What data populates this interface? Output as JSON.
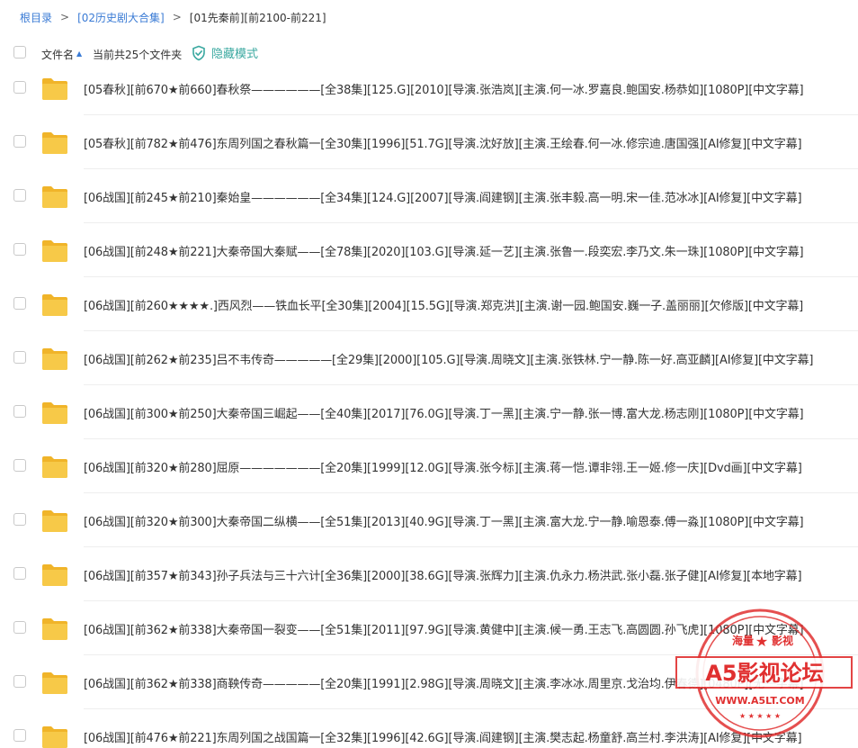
{
  "breadcrumb": {
    "root": "根目录",
    "parent": "[02历史剧大合集]",
    "current": "[01先秦前][前2100-前221]"
  },
  "header": {
    "sort_label": "文件名",
    "count_label": "当前共25个文件夹",
    "hide_mode_label": "隐藏模式"
  },
  "files": [
    "[05春秋][前670★前660]春秋祭——————[全38集][125.G][2010][导演.张浩岚][主演.何一冰.罗嘉良.鲍国安.杨恭如][1080P][中文字幕]",
    "[05春秋][前782★前476]东周列国之春秋篇一[全30集][1996][51.7G][导演.沈好放][主演.王绘春.何一冰.修宗迪.唐国强][AI修复][中文字幕]",
    "[06战国][前245★前210]秦始皇——————[全34集][124.G][2007][导演.阎建钢][主演.张丰毅.高一明.宋一佳.范冰冰][AI修复][中文字幕]",
    "[06战国][前248★前221]大秦帝国大秦赋——[全78集][2020][103.G][导演.延一艺][主演.张鲁一.段奕宏.李乃文.朱一珠][1080P][中文字幕]",
    "[06战国][前260★★★★.]西风烈——铁血长平[全30集][2004][15.5G][导演.郑克洪][主演.谢一园.鲍国安.巍一子.盖丽丽][欠修版][中文字幕]",
    "[06战国][前262★前235]吕不韦传奇—————[全29集][2000][105.G][导演.周晓文][主演.张铁林.宁一静.陈一好.高亚麟][AI修复][中文字幕]",
    "[06战国][前300★前250]大秦帝国三崛起——[全40集][2017][76.0G][导演.丁一黑][主演.宁一静.张一博.富大龙.杨志刚][1080P][中文字幕]",
    "[06战国][前320★前280]屈原———————[全20集][1999][12.0G][导演.张今标][主演.蒋一恺.谭非翎.王一姬.修一庆][Dvd画][中文字幕]",
    "[06战国][前320★前300]大秦帝国二纵横——[全51集][2013][40.9G][导演.丁一黑][主演.富大龙.宁一静.喻恩泰.傅一淼][1080P][中文字幕]",
    "[06战国][前357★前343]孙子兵法与三十六计[全36集][2000][38.6G][导演.张辉力][主演.仇永力.杨洪武.张小磊.张子健][AI修复][本地字幕]",
    "[06战国][前362★前338]大秦帝国一裂变——[全51集][2011][97.9G][导演.黄健中][主演.候一勇.王志飞.高圆圆.孙飞虎][1080P][中文字幕]",
    "[06战国][前362★前338]商鞅传奇—————[全20集][1991][2.98G][导演.周晓文][主演.李冰冰.周里京.戈治均.伊春德][0480P][无一字幕]",
    "[06战国][前476★前221]东周列国之战国篇一[全32集][1996][42.6G][导演.阎建钢][主演.樊志起.杨童舒.高兰村.李洪涛][AI修复][中文字幕]"
  ],
  "watermark": {
    "top_text": "海量",
    "top_text2": "影视",
    "main_text": "A5影视论坛",
    "url_text": "WWW.A5LT.COM"
  },
  "colors": {
    "link": "#3a7bd5",
    "hide_mode": "#3aa8a0",
    "folder": "#f7c948",
    "folder_dark": "#f0b429",
    "watermark_red": "#e03030"
  }
}
